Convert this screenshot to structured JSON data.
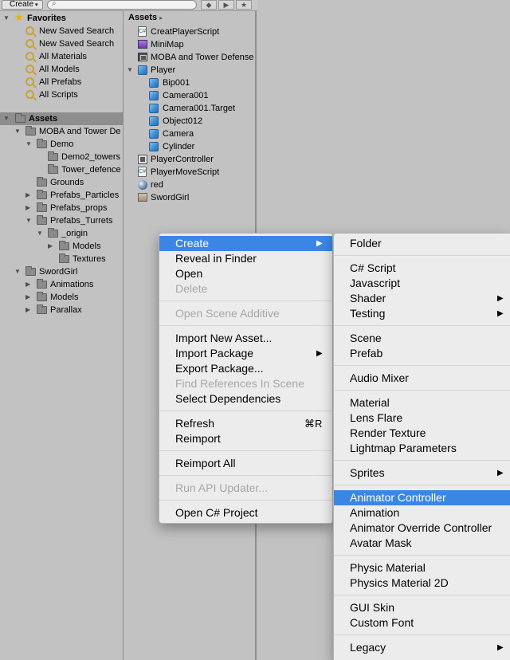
{
  "toolbar": {
    "create_label": "Create",
    "create_caret": "▾",
    "search_value": "",
    "search_icon": "⌕",
    "icons": [
      "tag-filter-icon",
      "label-icon",
      "star-filter-icon"
    ],
    "icon_glyphs": [
      "◆",
      "▶",
      "★"
    ]
  },
  "favorites": {
    "label": "Favorites",
    "items": [
      "New Saved Search",
      "New Saved Search",
      "All Materials",
      "All Models",
      "All Prefabs",
      "All Scripts"
    ]
  },
  "assets_tree": {
    "label": "Assets",
    "items": [
      {
        "label": "MOBA and Tower De",
        "indent": 1,
        "expanded": true
      },
      {
        "label": "Demo",
        "indent": 2,
        "expanded": true
      },
      {
        "label": "Demo2_towers",
        "indent": 3,
        "expanded": null
      },
      {
        "label": "Tower_defence",
        "indent": 3,
        "expanded": null
      },
      {
        "label": "Grounds",
        "indent": 2,
        "expanded": null
      },
      {
        "label": "Prefabs_Particles",
        "indent": 2,
        "expanded": false
      },
      {
        "label": "Prefabs_props",
        "indent": 2,
        "expanded": false
      },
      {
        "label": "Prefabs_Turrets",
        "indent": 2,
        "expanded": true
      },
      {
        "label": "_origin",
        "indent": 3,
        "expanded": true
      },
      {
        "label": "Models",
        "indent": 4,
        "expanded": false
      },
      {
        "label": "Textures",
        "indent": 4,
        "expanded": null
      },
      {
        "label": "SwordGirl",
        "indent": 1,
        "expanded": true
      },
      {
        "label": "Animations",
        "indent": 2,
        "expanded": false
      },
      {
        "label": "Models",
        "indent": 2,
        "expanded": false
      },
      {
        "label": "Parallax",
        "indent": 2,
        "expanded": false
      }
    ]
  },
  "mid": {
    "header": "Assets",
    "header_arrow": "▸",
    "items": [
      {
        "label": "CreatPlayerScript",
        "icon": "script-icon",
        "indent": 0
      },
      {
        "label": "MiniMap",
        "icon": "render-texture-icon",
        "indent": 0
      },
      {
        "label": "MOBA and Tower Defense",
        "icon": "scene-icon",
        "indent": 0
      },
      {
        "label": "Player",
        "icon": "prefab-cube-icon",
        "indent": 0,
        "expanded": true
      },
      {
        "label": "Bip001",
        "icon": "prefab-cube-icon",
        "indent": 1
      },
      {
        "label": "Camera001",
        "icon": "prefab-cube-icon",
        "indent": 1
      },
      {
        "label": "Camera001.Target",
        "icon": "prefab-cube-icon",
        "indent": 1
      },
      {
        "label": "Object012",
        "icon": "prefab-cube-icon",
        "indent": 1
      },
      {
        "label": "Camera",
        "icon": "prefab-cube-icon",
        "indent": 1
      },
      {
        "label": "Cylinder",
        "icon": "prefab-cube-icon",
        "indent": 1
      },
      {
        "label": "PlayerController",
        "icon": "animator-controller-icon",
        "indent": 0
      },
      {
        "label": "PlayerMoveScript",
        "icon": "script-icon",
        "indent": 0
      },
      {
        "label": "red",
        "icon": "material-sphere-icon",
        "indent": 0
      },
      {
        "label": "SwordGirl",
        "icon": "sprite-image-icon",
        "indent": 0
      }
    ]
  },
  "context_menu": {
    "items": [
      {
        "type": "item",
        "label": "Create",
        "submenu": true,
        "highlighted": true
      },
      {
        "type": "item",
        "label": "Reveal in Finder"
      },
      {
        "type": "item",
        "label": "Open"
      },
      {
        "type": "item",
        "label": "Delete",
        "disabled": true
      },
      {
        "type": "sep"
      },
      {
        "type": "item",
        "label": "Open Scene Additive",
        "disabled": true
      },
      {
        "type": "sep"
      },
      {
        "type": "item",
        "label": "Import New Asset..."
      },
      {
        "type": "item",
        "label": "Import Package",
        "submenu": true
      },
      {
        "type": "item",
        "label": "Export Package..."
      },
      {
        "type": "item",
        "label": "Find References In Scene",
        "disabled": true
      },
      {
        "type": "item",
        "label": "Select Dependencies"
      },
      {
        "type": "sep"
      },
      {
        "type": "item",
        "label": "Refresh",
        "shortcut": "⌘R"
      },
      {
        "type": "item",
        "label": "Reimport"
      },
      {
        "type": "sep"
      },
      {
        "type": "item",
        "label": "Reimport All"
      },
      {
        "type": "sep"
      },
      {
        "type": "item",
        "label": "Run API Updater...",
        "disabled": true
      },
      {
        "type": "sep"
      },
      {
        "type": "item",
        "label": "Open C# Project"
      }
    ]
  },
  "create_submenu": {
    "items": [
      {
        "type": "item",
        "label": "Folder"
      },
      {
        "type": "sep"
      },
      {
        "type": "item",
        "label": "C# Script"
      },
      {
        "type": "item",
        "label": "Javascript"
      },
      {
        "type": "item",
        "label": "Shader",
        "submenu": true
      },
      {
        "type": "item",
        "label": "Testing",
        "submenu": true
      },
      {
        "type": "sep"
      },
      {
        "type": "item",
        "label": "Scene"
      },
      {
        "type": "item",
        "label": "Prefab"
      },
      {
        "type": "sep"
      },
      {
        "type": "item",
        "label": "Audio Mixer"
      },
      {
        "type": "sep"
      },
      {
        "type": "item",
        "label": "Material"
      },
      {
        "type": "item",
        "label": "Lens Flare"
      },
      {
        "type": "item",
        "label": "Render Texture"
      },
      {
        "type": "item",
        "label": "Lightmap Parameters"
      },
      {
        "type": "sep"
      },
      {
        "type": "item",
        "label": "Sprites",
        "submenu": true
      },
      {
        "type": "sep"
      },
      {
        "type": "item",
        "label": "Animator Controller",
        "highlighted": true
      },
      {
        "type": "item",
        "label": "Animation"
      },
      {
        "type": "item",
        "label": "Animator Override Controller"
      },
      {
        "type": "item",
        "label": "Avatar Mask"
      },
      {
        "type": "sep"
      },
      {
        "type": "item",
        "label": "Physic Material"
      },
      {
        "type": "item",
        "label": "Physics Material 2D"
      },
      {
        "type": "sep"
      },
      {
        "type": "item",
        "label": "GUI Skin"
      },
      {
        "type": "item",
        "label": "Custom Font"
      },
      {
        "type": "sep"
      },
      {
        "type": "item",
        "label": "Legacy",
        "submenu": true
      }
    ]
  },
  "glyphs": {
    "expanded": "▼",
    "collapsed": "▶",
    "star": "★",
    "submenu_arrow": "▶"
  },
  "colors": {
    "selection_blue": "#3b86e5",
    "panel_bg": "#c2c2c2",
    "menu_bg": "#ececec",
    "disabled_text": "#a7a7a7"
  }
}
